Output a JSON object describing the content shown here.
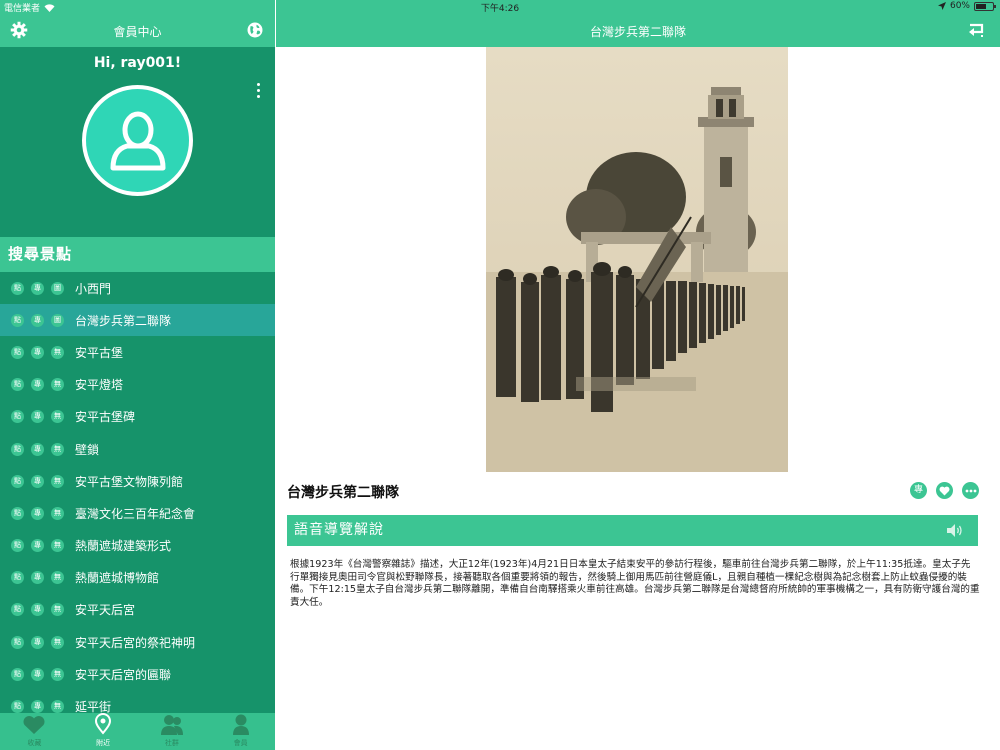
{
  "status": {
    "carrier": "電信業者",
    "time": "下午4:26",
    "battery": "60%",
    "battery_level": 0.6
  },
  "sidebar": {
    "title": "會員中心",
    "greeting": "Hi, ray001!",
    "section_title": "搜尋景點",
    "items": [
      {
        "tags": [
          "點",
          "專",
          "圖"
        ],
        "label": "小西門"
      },
      {
        "tags": [
          "點",
          "專",
          "圖"
        ],
        "label": "台灣步兵第二聯隊"
      },
      {
        "tags": [
          "點",
          "專",
          "無"
        ],
        "label": "安平古堡"
      },
      {
        "tags": [
          "點",
          "專",
          "無"
        ],
        "label": "安平燈塔"
      },
      {
        "tags": [
          "點",
          "專",
          "無"
        ],
        "label": "安平古堡碑"
      },
      {
        "tags": [
          "點",
          "專",
          "無"
        ],
        "label": "壁鎖"
      },
      {
        "tags": [
          "點",
          "專",
          "無"
        ],
        "label": "安平古堡文物陳列館"
      },
      {
        "tags": [
          "點",
          "專",
          "無"
        ],
        "label": "臺灣文化三百年紀念會"
      },
      {
        "tags": [
          "點",
          "專",
          "無"
        ],
        "label": "熱蘭遮城建築形式"
      },
      {
        "tags": [
          "點",
          "專",
          "無"
        ],
        "label": "熱蘭遮城博物館"
      },
      {
        "tags": [
          "點",
          "專",
          "無"
        ],
        "label": "安平天后宮"
      },
      {
        "tags": [
          "點",
          "專",
          "無"
        ],
        "label": "安平天后宮的祭祀神明"
      },
      {
        "tags": [
          "點",
          "專",
          "無"
        ],
        "label": "安平天后宮的匾聯"
      },
      {
        "tags": [
          "點",
          "專",
          "無"
        ],
        "label": "延平街"
      }
    ],
    "selected_index": 1,
    "tabs": [
      {
        "label": "收藏",
        "icon": "heart-icon"
      },
      {
        "label": "附近",
        "icon": "location-pin-icon",
        "active": true
      },
      {
        "label": "社群",
        "icon": "people-icon"
      },
      {
        "label": "會員",
        "icon": "person-icon"
      }
    ]
  },
  "main": {
    "header_title": "台灣步兵第二聯隊",
    "item_title": "台灣步兵第二聯隊",
    "action_special": "專",
    "guide_title": "語音導覽解說",
    "description": "根據1923年《台灣警察雜誌》描述，大正12年(1923年)4月21日日本皇太子結束安平的參訪行程後，驅車前往台灣步兵第二聯隊，於上午11:35抵達。皇太子先行單獨接見奧田司令官與松野聯隊長，接著聽取各個重要將領的報告，然後騎上御用馬匹前往營庭儀L，且親自種植一棵紀念樹與為記念樹套上防止蚊蟲侵擾的裝備。下午12:15皇太子自台灣步兵第二聯隊離開，準備自台南驛搭乘火車前往高雄。台灣步兵第二聯隊是台灣總督府所統帥的軍事機構之一，具有防衛守護台灣的重責大任。"
  },
  "colors": {
    "accent": "#3cc593",
    "sidebar_bg": "#16936a",
    "selected_row": "#28a699",
    "avatar_fill": "#2fd6b6"
  }
}
